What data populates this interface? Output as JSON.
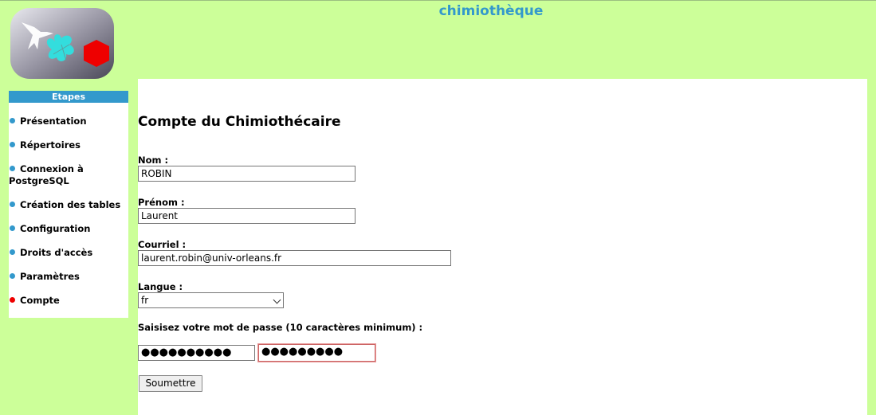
{
  "header": {
    "site_title": "chimiothèque"
  },
  "sidebar": {
    "title": "Etapes",
    "items": [
      {
        "label": "Présentation",
        "active": false
      },
      {
        "label": "Répertoires",
        "active": false
      },
      {
        "label": "Connexion à PostgreSQL",
        "active": false
      },
      {
        "label": "Création des tables",
        "active": false
      },
      {
        "label": "Configuration",
        "active": false
      },
      {
        "label": "Droits d'accès",
        "active": false
      },
      {
        "label": "Paramètres",
        "active": false
      },
      {
        "label": "Compte",
        "active": true
      }
    ]
  },
  "form": {
    "title": "Compte du Chimiothécaire",
    "nom_label": "Nom :",
    "nom_value": "ROBIN",
    "prenom_label": "Prénom :",
    "prenom_value": "Laurent",
    "courriel_label": "Courriel :",
    "courriel_value": "laurent.robin@univ-orleans.fr",
    "langue_label": "Langue :",
    "langue_value": "fr",
    "password_label": "Saisisez votre mot de passe (10 caractères minimum) :",
    "password_value": "●●●●●●●●●●",
    "password_confirm_value": "●●●●●●●●●",
    "submit_label": "Soumettre"
  },
  "colors": {
    "page_bg": "#ccff99",
    "accent": "#3399cc",
    "active_dot": "#ee0000"
  }
}
